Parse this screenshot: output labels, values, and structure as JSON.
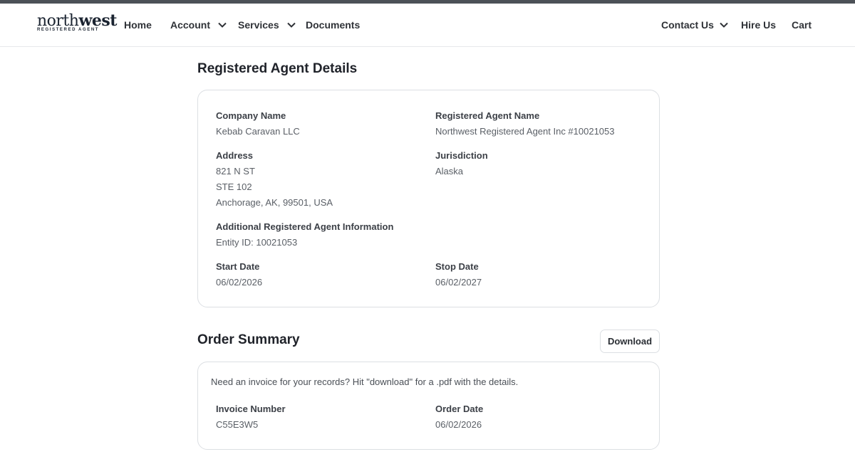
{
  "brand": {
    "name_bold": "north",
    "name_regular": "west",
    "tagline": "REGISTERED AGENT"
  },
  "nav": {
    "home": "Home",
    "account": "Account",
    "services": "Services",
    "documents": "Documents",
    "contact": "Contact Us",
    "hire": "Hire Us",
    "cart": "Cart"
  },
  "agent_details": {
    "title": "Registered Agent Details",
    "company_name_label": "Company Name",
    "company_name": "Kebab Caravan LLC",
    "agent_name_label": "Registered Agent Name",
    "agent_name": "Northwest Registered Agent Inc #10021053",
    "address_label": "Address",
    "address_lines": [
      "821 N ST",
      "STE 102",
      "Anchorage, AK, 99501, USA"
    ],
    "jurisdiction_label": "Jurisdiction",
    "jurisdiction": "Alaska",
    "additional_label": "Additional Registered Agent Information",
    "additional_value": "Entity ID: 10021053",
    "start_date_label": "Start Date",
    "start_date": "06/02/2026",
    "stop_date_label": "Stop Date",
    "stop_date": "06/02/2027"
  },
  "order_summary": {
    "title": "Order Summary",
    "download_label": "Download",
    "note": "Need an invoice for your records? Hit \"download\" for a .pdf with the details.",
    "invoice_label": "Invoice Number",
    "invoice_number": "C55E3W5",
    "order_date_label": "Order Date",
    "order_date": "06/02/2026"
  }
}
